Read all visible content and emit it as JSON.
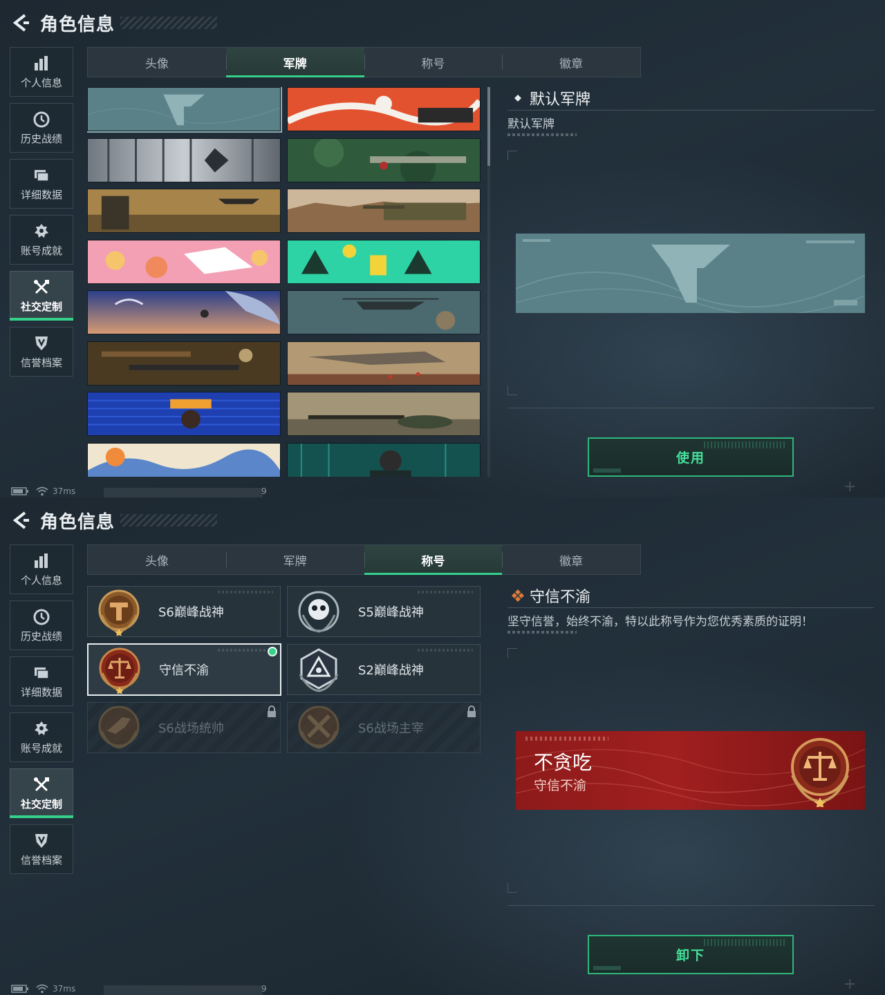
{
  "colors": {
    "accent": "#35d08a",
    "background": "#1e2a33",
    "title_red": "#a11f1f"
  },
  "header": {
    "title": "角色信息",
    "back_icon": "chevron-left-icon"
  },
  "sidebar": {
    "items": [
      {
        "label": "个人信息",
        "icon": "bar-chart-icon"
      },
      {
        "label": "历史战绩",
        "icon": "clock-icon"
      },
      {
        "label": "详细数据",
        "icon": "folder-icon"
      },
      {
        "label": "账号成就",
        "icon": "medal-icon"
      },
      {
        "label": "社交定制",
        "icon": "tools-icon",
        "active": true
      },
      {
        "label": "信誉档案",
        "icon": "shield-icon"
      }
    ]
  },
  "tabs": [
    "头像",
    "军牌",
    "称号",
    "徽章"
  ],
  "status": {
    "ping": "37ms",
    "trailing": "9"
  },
  "screen1": {
    "active_tab": "军牌",
    "detail": {
      "title": "默认军牌",
      "description": "默认军牌"
    },
    "action_label": "使用"
  },
  "screen2": {
    "active_tab": "称号",
    "titles": [
      {
        "name": "S6巅峰战神"
      },
      {
        "name": "S5巅峰战神"
      },
      {
        "name": "守信不渝",
        "selected": true
      },
      {
        "name": "S2巅峰战神"
      },
      {
        "name": "S6战场统帅",
        "locked": true
      },
      {
        "name": "S6战场主宰",
        "locked": true
      }
    ],
    "detail": {
      "title": "守信不渝",
      "description": "坚守信誉，始终不渝，特以此称号作为您优秀素质的证明！"
    },
    "preview": {
      "player_name": "不贪吃",
      "title": "守信不渝"
    },
    "action_label": "卸下"
  }
}
